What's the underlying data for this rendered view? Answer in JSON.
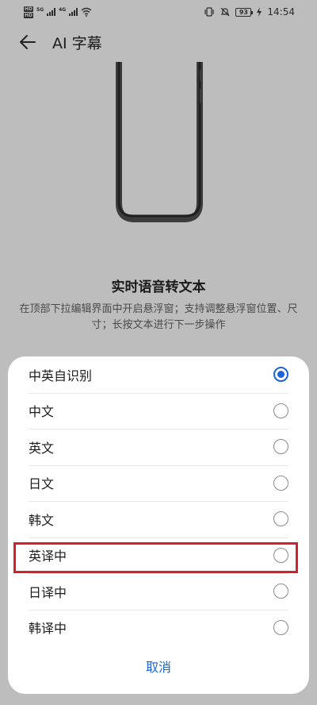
{
  "status_bar": {
    "sim1": [
      "HD",
      "1"
    ],
    "sim2": [
      "HD",
      "2"
    ],
    "net1": "5G",
    "net2": "4G",
    "battery": "93",
    "time": "14:54"
  },
  "header": {
    "title": "AI 字幕"
  },
  "feature": {
    "title": "实时语音转文本",
    "description": "在顶部下拉编辑界面中开启悬浮窗；支持调整悬浮窗位置、尺寸；长按文本进行下一步操作"
  },
  "sheet": {
    "options": [
      {
        "label": "中英自识别",
        "selected": true
      },
      {
        "label": "中文",
        "selected": false
      },
      {
        "label": "英文",
        "selected": false
      },
      {
        "label": "日文",
        "selected": false
      },
      {
        "label": "韩文",
        "selected": false
      },
      {
        "label": "英译中",
        "selected": false
      },
      {
        "label": "日译中",
        "selected": false
      },
      {
        "label": "韩译中",
        "selected": false
      }
    ],
    "cancel_label": "取消"
  },
  "colors": {
    "accent": "#1d63d6",
    "highlight": "#d6202c",
    "background": "#bdbdbd"
  }
}
